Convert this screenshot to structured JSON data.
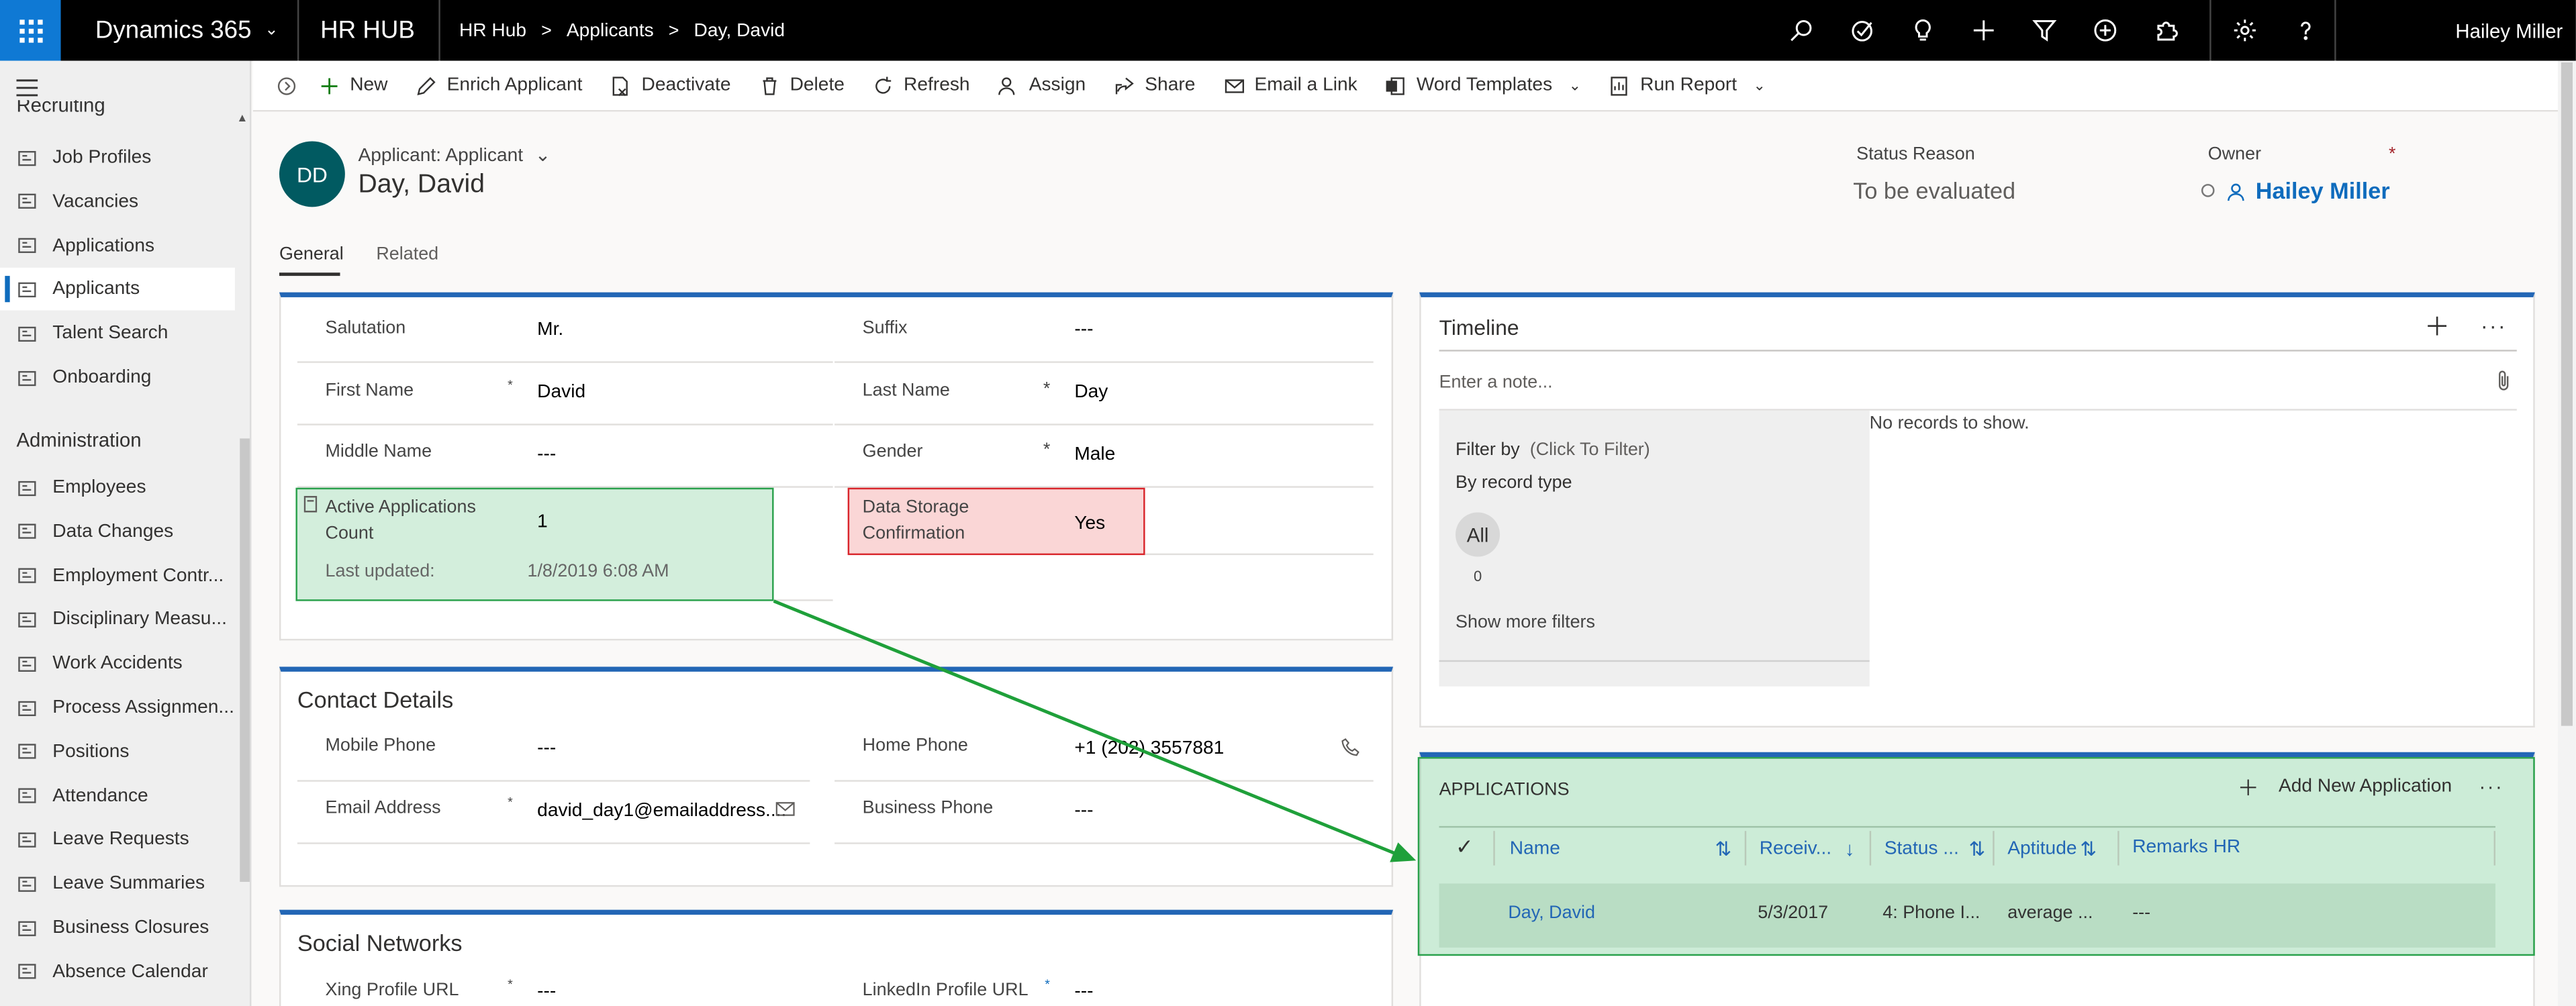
{
  "topbar": {
    "app_name": "Dynamics 365",
    "hub": "HR HUB",
    "breadcrumb": [
      "HR Hub",
      "Applicants",
      "Day, David"
    ],
    "user": "Hailey Miller"
  },
  "sidebar": {
    "cut_label": "Recruiting",
    "items_top": [
      {
        "label": "Job Profiles",
        "icon": "job-profiles-icon"
      },
      {
        "label": "Vacancies",
        "icon": "vacancies-icon"
      },
      {
        "label": "Applications",
        "icon": "applications-icon"
      },
      {
        "label": "Applicants",
        "icon": "applicants-icon",
        "active": true
      },
      {
        "label": "Talent Search",
        "icon": "talent-search-icon"
      },
      {
        "label": "Onboarding",
        "icon": "onboarding-icon"
      }
    ],
    "admin_heading": "Administration",
    "items_admin": [
      {
        "label": "Employees",
        "icon": "employees-icon"
      },
      {
        "label": "Data Changes",
        "icon": "data-changes-icon"
      },
      {
        "label": "Employment Contr...",
        "icon": "contract-icon"
      },
      {
        "label": "Disciplinary Measu...",
        "icon": "disciplinary-icon"
      },
      {
        "label": "Work Accidents",
        "icon": "work-accidents-icon"
      },
      {
        "label": "Process Assignmen...",
        "icon": "process-icon"
      },
      {
        "label": "Positions",
        "icon": "positions-icon"
      },
      {
        "label": "Attendance",
        "icon": "attendance-icon"
      },
      {
        "label": "Leave Requests",
        "icon": "leave-requests-icon"
      },
      {
        "label": "Leave Summaries",
        "icon": "leave-summaries-icon"
      },
      {
        "label": "Business Closures",
        "icon": "business-closures-icon"
      },
      {
        "label": "Absence Calendar",
        "icon": "absence-calendar-icon"
      }
    ]
  },
  "commands": [
    "New",
    "Enrich Applicant",
    "Deactivate",
    "Delete",
    "Refresh",
    "Assign",
    "Share",
    "Email a Link",
    "Word Templates",
    "Run Report"
  ],
  "header": {
    "initials": "DD",
    "entity": "Applicant: Applicant",
    "name": "Day, David",
    "status_label": "Status Reason",
    "status_value": "To be evaluated",
    "owner_label": "Owner",
    "owner_value": "Hailey Miller"
  },
  "tabs": [
    "General",
    "Related"
  ],
  "general": {
    "salutation_label": "Salutation",
    "salutation": "Mr.",
    "suffix_label": "Suffix",
    "suffix": "---",
    "first_name_label": "First Name",
    "first_name": "David",
    "last_name_label": "Last Name",
    "last_name": "Day",
    "middle_name_label": "Middle Name",
    "middle_name": "---",
    "gender_label": "Gender",
    "gender": "Male",
    "active_apps_label_1": "Active Applications",
    "active_apps_label_2": "Count",
    "active_apps": "1",
    "last_updated_label": "Last updated:",
    "last_updated": "1/8/2019 6:08 AM",
    "data_storage_label_1": "Data Storage",
    "data_storage_label_2": "Confirmation",
    "data_storage": "Yes"
  },
  "contact": {
    "title": "Contact Details",
    "mobile_label": "Mobile Phone",
    "mobile": "---",
    "home_label": "Home Phone",
    "home": "+1 (202) 3557881",
    "email_label": "Email Address",
    "email": "david_day1@emailaddress....",
    "business_label": "Business Phone",
    "business": "---"
  },
  "social": {
    "title": "Social Networks",
    "xing_label": "Xing Profile URL",
    "xing": "---",
    "linkedin_label": "LinkedIn Profile URL",
    "linkedin": "---"
  },
  "timeline": {
    "title": "Timeline",
    "note_placeholder": "Enter a note...",
    "filter_by": "Filter by",
    "click_to_filter": "(Click To Filter)",
    "by_record_type": "By record type",
    "all": "All",
    "all_count": "0",
    "show_more": "Show more filters",
    "empty": "No records to show."
  },
  "applications": {
    "title": "APPLICATIONS",
    "add_new": "Add New Application",
    "columns": [
      "Name",
      "Receiv...",
      "Status ...",
      "Aptitude",
      "Remarks HR"
    ],
    "rows": [
      {
        "name": "Day, David",
        "received": "5/3/2017",
        "status": "4: Phone I...",
        "aptitude": "average ...",
        "remarks": "---"
      }
    ]
  },
  "colors": {
    "accent": "#2266b5",
    "waffle": "#0f79d4",
    "avatar": "#015a61",
    "highlight_green": "#2aa14c",
    "highlight_red": "#d9262c"
  }
}
